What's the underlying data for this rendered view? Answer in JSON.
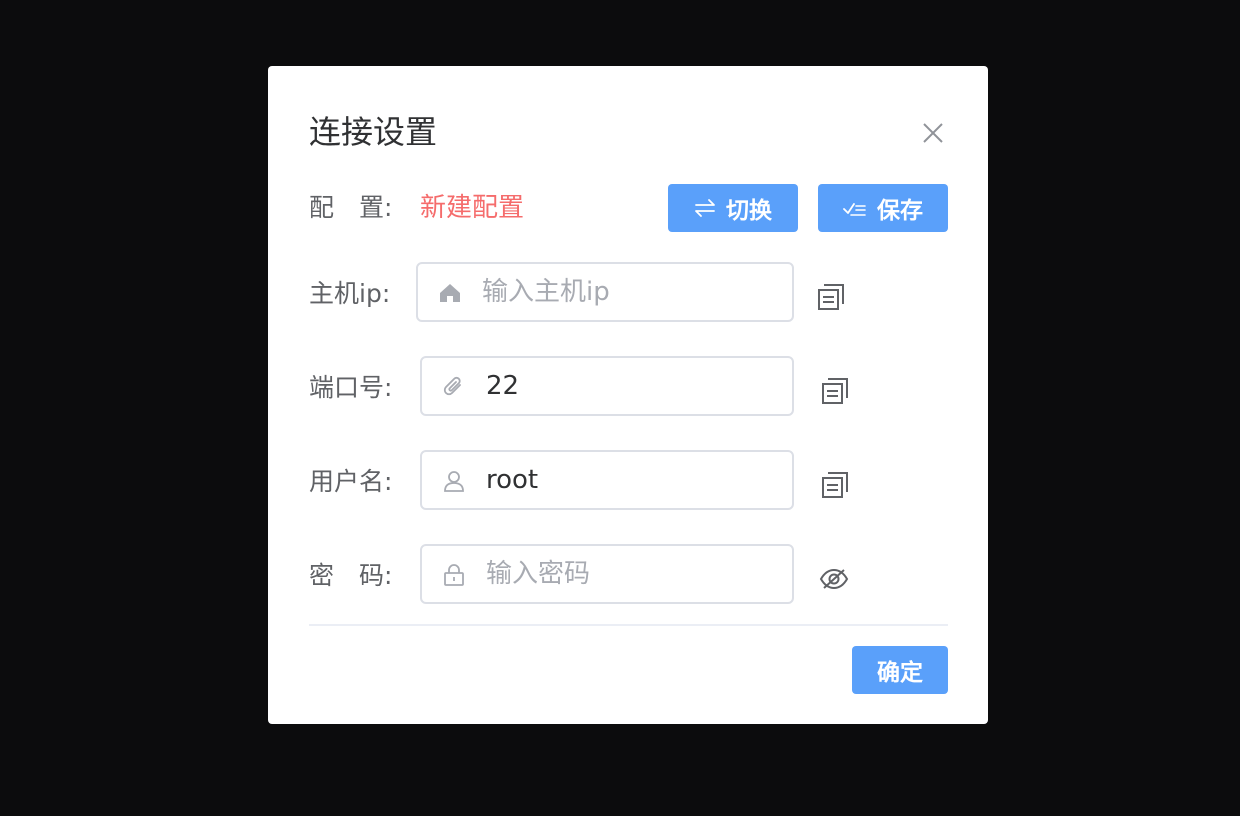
{
  "dialog": {
    "title": "连接设置",
    "config": {
      "label": "配　置:",
      "name": "新建配置",
      "switch_label": "切换",
      "save_label": "保存"
    },
    "fields": {
      "host": {
        "label": "主机ip:",
        "value": "",
        "placeholder": "输入主机ip"
      },
      "port": {
        "label": "端口号:",
        "value": "22",
        "placeholder": ""
      },
      "user": {
        "label": "用户名:",
        "value": "root",
        "placeholder": ""
      },
      "password": {
        "label": "密　码:",
        "value": "",
        "placeholder": "输入密码"
      }
    },
    "confirm_label": "确定"
  },
  "colors": {
    "primary": "#5aa0fa",
    "danger": "#f56c6c",
    "overlay": "#0c0c0d"
  },
  "icons": {
    "close": "close-icon",
    "switch": "switch-icon",
    "save": "save-icon",
    "host": "house-icon",
    "port": "paperclip-icon",
    "user": "user-icon",
    "password": "lock-icon",
    "copy": "copy-icon",
    "visibility": "eye-off-icon"
  }
}
